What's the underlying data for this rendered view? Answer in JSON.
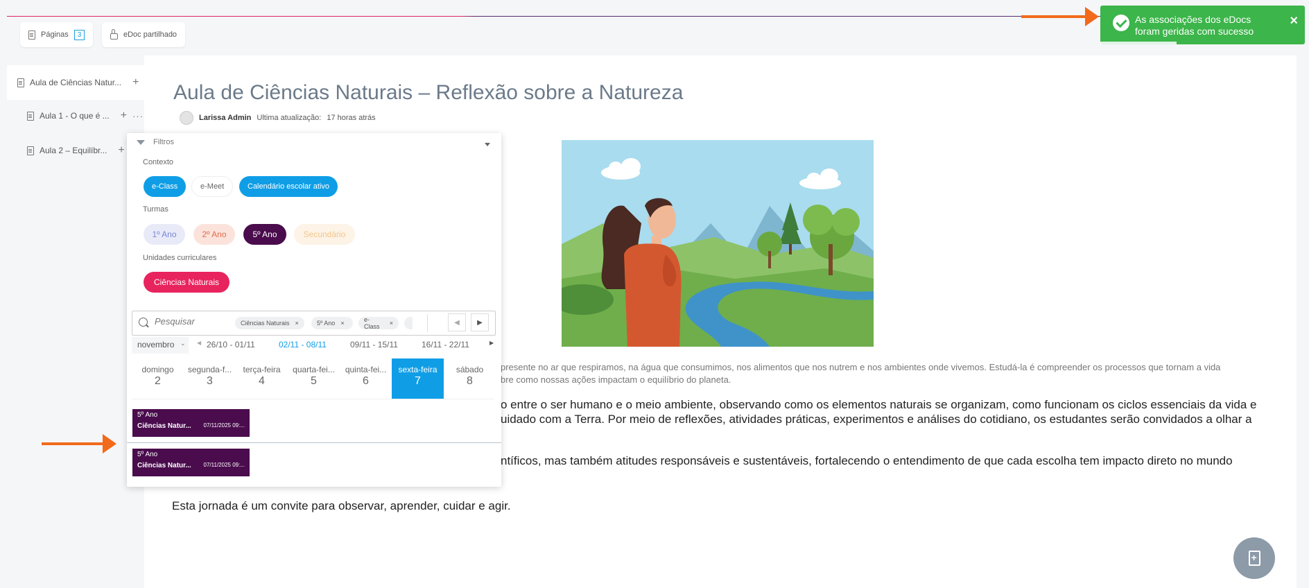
{
  "topbar": {
    "pages_label": "Páginas",
    "pages_count": "3",
    "shared_label": "eDoc partilhado"
  },
  "sidebar": {
    "items": [
      {
        "label": "Aula de Ciências Natur..."
      },
      {
        "label": "Aula 1 - O que é ..."
      },
      {
        "label": "Aula 2 – Equilíbr..."
      }
    ]
  },
  "document": {
    "title": "Aula de Ciências Naturais – Reflexão sobre a Natureza",
    "author": "Larissa Admin",
    "updated_label": "Ultima atualização:",
    "updated_value": "17 horas atrás",
    "caption_line1": "presente no ar que respiramos, na água que consumimos, nos alimentos que nos nutrem e nos ambientes onde vivemos. Estudá-la é compreender os processos que tornam a vida",
    "caption_line2": "bre como nossas ações impactam o equilíbrio do planeta.",
    "p1_line1": "o entre o ser humano e o meio ambiente, observando como os elementos naturais se organizam, como funcionam os ciclos essenciais da vida e",
    "p1_line2": "uidado com a Terra. Por meio de reflexões, atividades práticas, experimentos e análises do cotidiano, os estudantes serão convidados a olhar a",
    "p2_line1": "ntíficos, mas também atitudes responsáveis e sustentáveis, fortalecendo o entendimento de que cada escolha tem impacto direto no mundo",
    "p3": "Esta jornada é um convite para observar, aprender, cuidar e agir."
  },
  "toast": {
    "message": "As associações dos eDocs foram geridas com sucesso",
    "close": "×",
    "color": "#3cb54a"
  },
  "filters": {
    "title": "Filtros",
    "context_label": "Contexto",
    "context": [
      {
        "label": "e-Class",
        "active": true
      },
      {
        "label": "e-Meet",
        "active": false
      },
      {
        "label": "Calendário escolar ativo",
        "active": true
      }
    ],
    "classes_label": "Turmas",
    "classes": [
      {
        "label": "1º Ano"
      },
      {
        "label": "2º Ano"
      },
      {
        "label": "5º Ano",
        "active": true
      },
      {
        "label": "Secundário"
      }
    ],
    "units_label": "Unidades curriculares",
    "units": [
      {
        "label": "Ciências Naturais",
        "active": true
      }
    ],
    "search_placeholder": "Pesquisar",
    "tags": [
      {
        "label": "Ciências Naturais"
      },
      {
        "label": "5º Ano"
      },
      {
        "label": "e-Class"
      }
    ],
    "month": "novembro",
    "weeks": [
      "26/10 - 01/11",
      "02/11 - 08/11",
      "09/11 - 15/11",
      "16/11 - 22/11"
    ],
    "active_week": "02/11 - 08/11",
    "days": [
      {
        "name": "domingo",
        "num": "2"
      },
      {
        "name": "segunda-f...",
        "num": "3"
      },
      {
        "name": "terça-feira",
        "num": "4"
      },
      {
        "name": "quarta-fei...",
        "num": "5"
      },
      {
        "name": "quinta-fei...",
        "num": "6"
      },
      {
        "name": "sexta-feira",
        "num": "7",
        "active": true
      },
      {
        "name": "sábado",
        "num": "8"
      }
    ],
    "events": [
      {
        "class": "5º Ano",
        "subject": "Ciências Natur...",
        "date": "07/11/2025 09:..."
      },
      {
        "class": "5º Ano",
        "subject": "Ciências Natur...",
        "date": "07/11/2025 09:..."
      }
    ]
  },
  "colors": {
    "accent": "#0f9ee6",
    "event": "#4a0c4d",
    "brand_pink": "#e0245e",
    "arrow": "#f26a1b"
  }
}
